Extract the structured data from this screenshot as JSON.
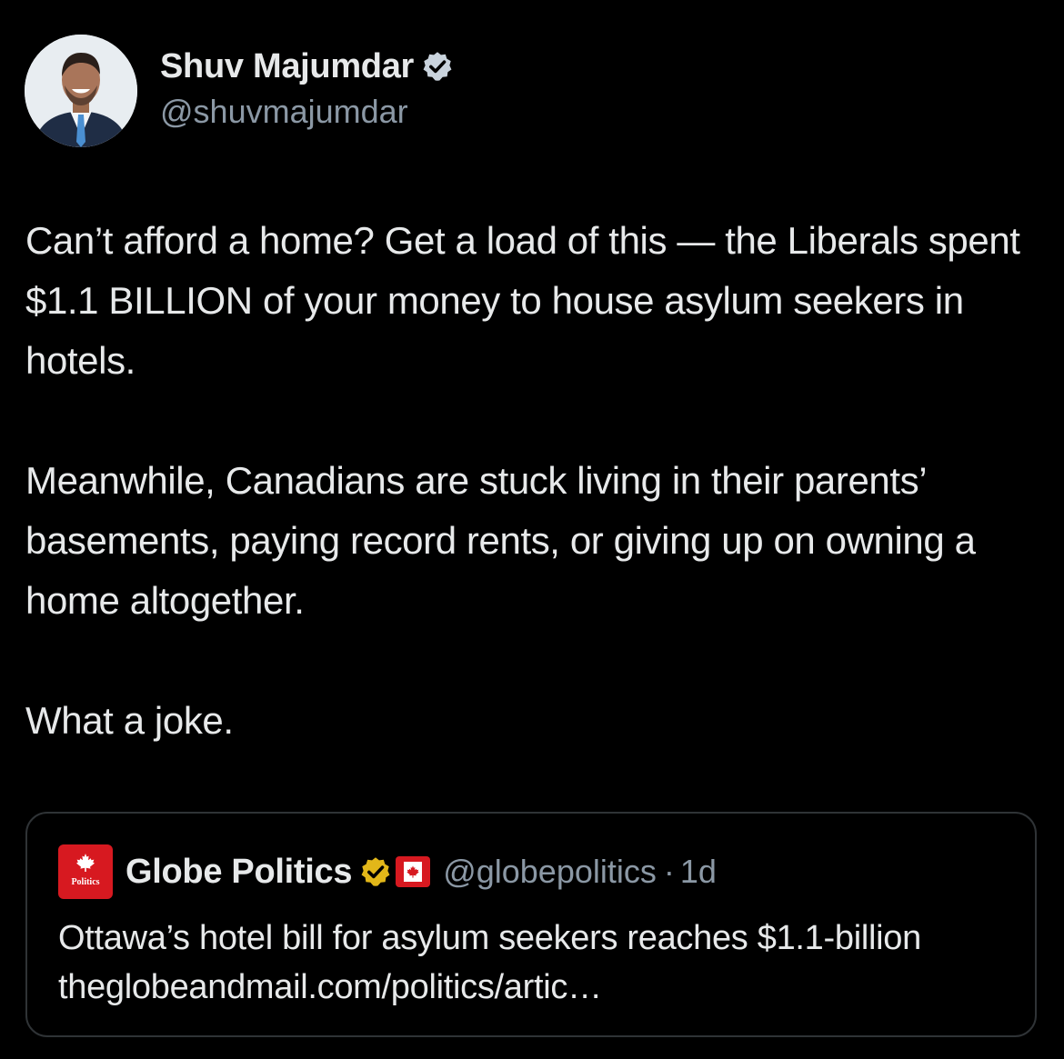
{
  "author": {
    "display_name": "Shuv Majumdar",
    "handle": "@shuvmajumdar",
    "verified_color": "#c9d3dd"
  },
  "tweet": {
    "paragraphs": [
      "Can’t afford a home? Get a load of this — the Liberals spent $1.1 BILLION of your money to house asylum seekers in hotels.",
      "Meanwhile, Canadians are stuck living in their parents’ basements, paying record rents, or giving up on owning a home altogether.",
      "What a joke."
    ]
  },
  "quote": {
    "avatar_label": "Politics",
    "display_name": "Globe Politics",
    "handle": "@globepolitics",
    "separator": "·",
    "time": "1d",
    "text": "Ottawa’s hotel bill for asylum seekers reaches $1.1-billion theglobeandmail.com/politics/artic…",
    "brand_color": "#d71920",
    "badge_color": "#e2b719"
  },
  "colors": {
    "background": "#000000",
    "text": "#e7e9ea",
    "secondary": "#8b98a5",
    "border": "#2f3336"
  }
}
